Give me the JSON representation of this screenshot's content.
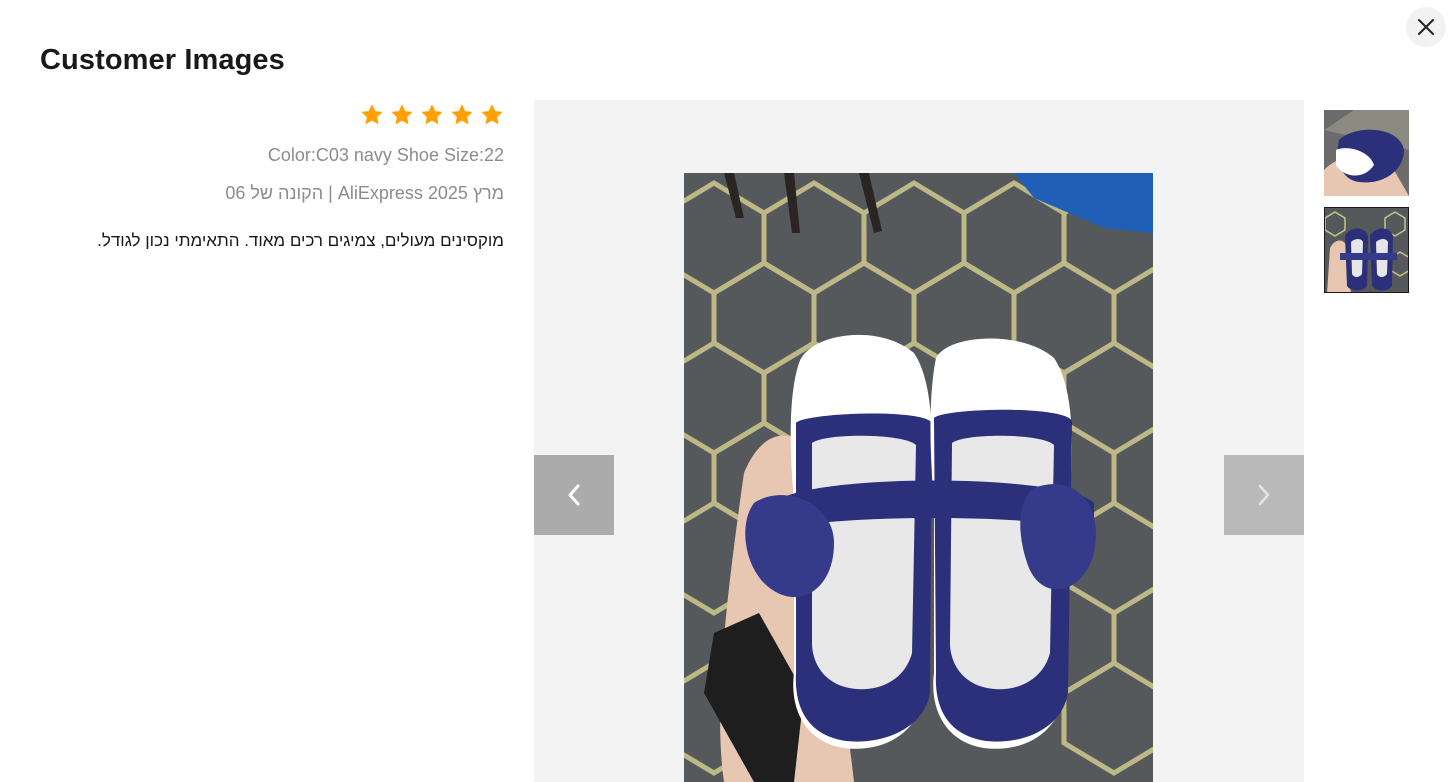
{
  "modal": {
    "title": "Customer Images",
    "close_icon": "close-icon"
  },
  "review": {
    "rating": 5,
    "rating_max": 5,
    "sku": "Color:C03 navy Shoe Size:22",
    "purchase_info": "הקונה של 06 | AliExpress מרץ 2025",
    "comment": "מוקסינים מעולים, צמיגים רכים מאוד. התאימתי נכון לגודל."
  },
  "viewer": {
    "prev_icon": "chevron-left-icon",
    "next_icon": "chevron-right-icon",
    "active_index": 1,
    "thumbnails": [
      {
        "name": "thumbnail-1"
      },
      {
        "name": "thumbnail-2"
      }
    ]
  },
  "colors": {
    "star": "#ff9f00",
    "shoe": "#2c2f7a",
    "text": "#191919",
    "muted": "#8c8c8c"
  }
}
